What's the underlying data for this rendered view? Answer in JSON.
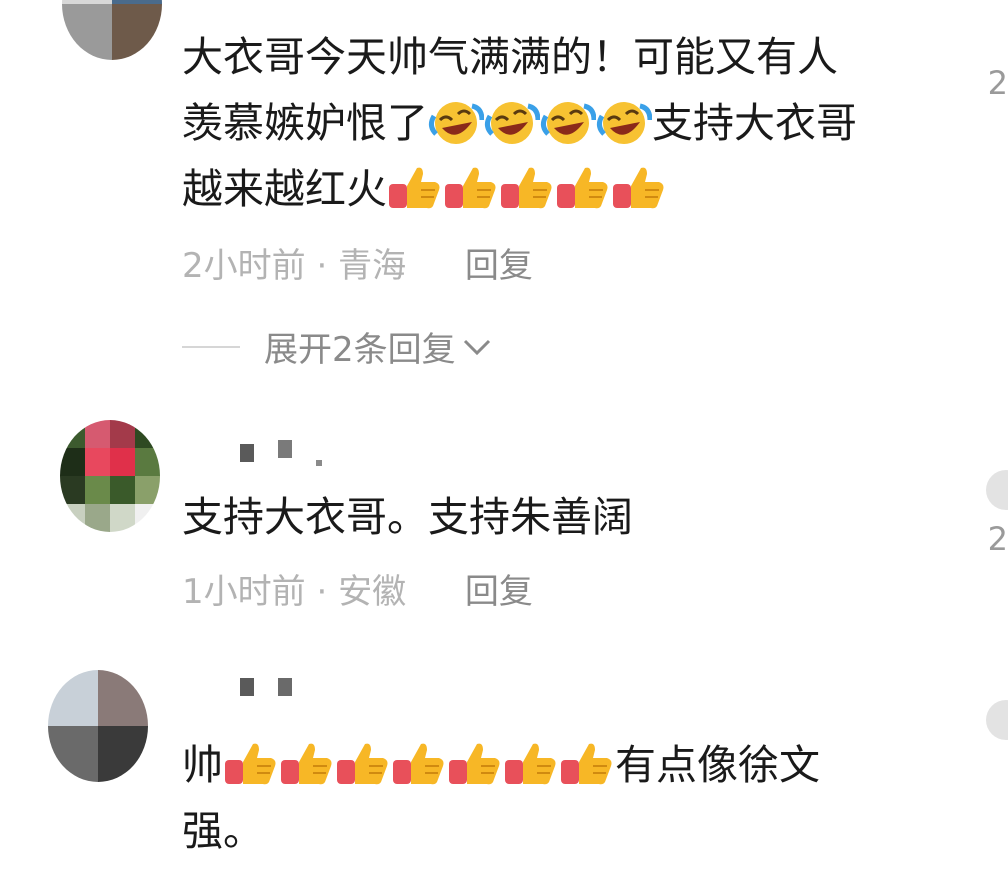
{
  "comments": [
    {
      "text_line1": "大衣哥今天帅气满满的！可能又有人",
      "text_line2": "羡慕嫉妒恨了",
      "text_line2_after": "支持大衣哥",
      "text_line3": "越来越红火",
      "time": "2小时前",
      "location": "青海",
      "reply_label": "回复",
      "laugh_count": 4,
      "thumbs_count": 5
    },
    {
      "text": "支持大衣哥。支持朱善阔",
      "time": "1小时前",
      "location": "安徽",
      "reply_label": "回复"
    },
    {
      "text_before": "帅",
      "text_after": "有点像徐文",
      "text_line2": "强。",
      "thumbs_count": 7
    }
  ],
  "expand_replies_label": "展开2条回复",
  "meta_separator": "·",
  "right_edge_digits": [
    "2",
    "2"
  ],
  "icons": {
    "laugh": "face-with-tears-of-joy-icon",
    "thumbs": "thumbs-up-icon",
    "chevron": "chevron-down-icon",
    "like": "like-icon"
  }
}
